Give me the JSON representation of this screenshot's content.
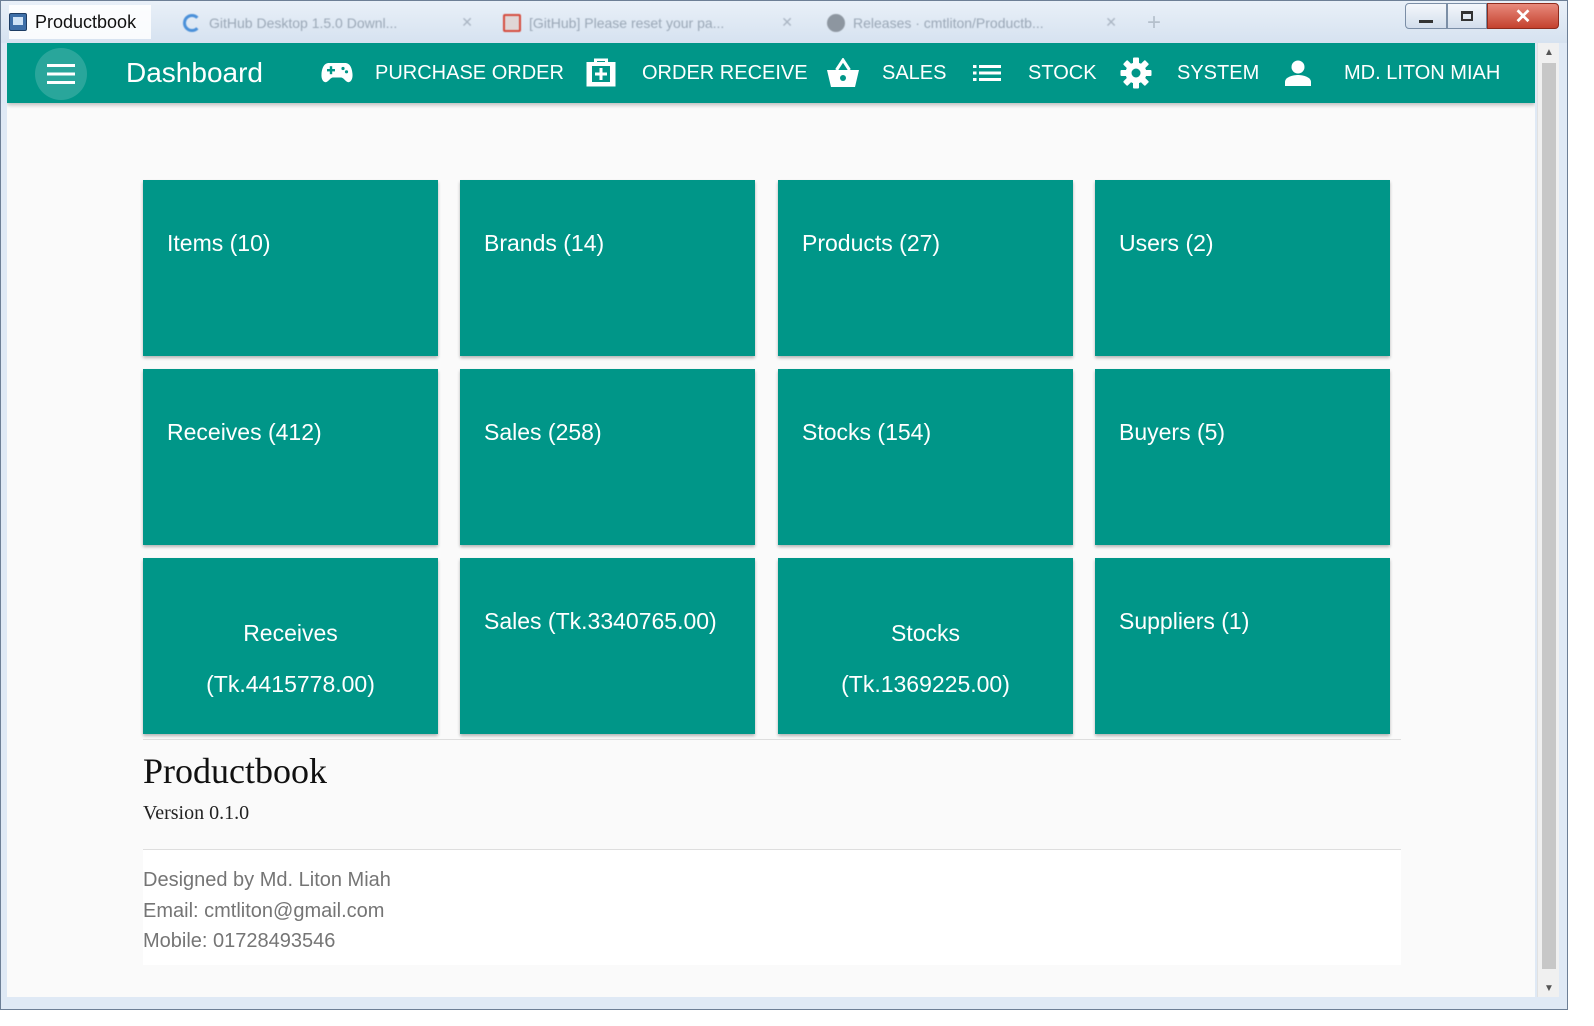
{
  "window": {
    "title": "Productbook",
    "browser_tabs": [
      "GitHub Desktop 1.5.0 Downl...",
      "[GitHub] Please reset your pa...",
      "Releases · cmtliton/Productb..."
    ]
  },
  "toolbar": {
    "page_title": "Dashboard",
    "nav": [
      {
        "label": "PURCHASE ORDER",
        "icon": "gamepad-icon"
      },
      {
        "label": "ORDER RECEIVE",
        "icon": "add-box-icon"
      },
      {
        "label": "SALES",
        "icon": "shopping-basket-icon"
      },
      {
        "label": "STOCK",
        "icon": "list-icon"
      },
      {
        "label": "SYSTEM",
        "icon": "gear-icon"
      },
      {
        "label": "MD. LITON MIAH",
        "icon": "person-icon"
      }
    ]
  },
  "tiles": [
    {
      "label": "Items (10)"
    },
    {
      "label": "Brands (14)"
    },
    {
      "label": "Products (27)"
    },
    {
      "label": "Users (2)"
    },
    {
      "label": "Receives (412)"
    },
    {
      "label": "Sales (258)"
    },
    {
      "label": "Stocks (154)"
    },
    {
      "label": "Buyers (5)"
    },
    {
      "line1": "Receives",
      "line2": "(Tk.4415778.00)"
    },
    {
      "label": "Sales (Tk.3340765.00)"
    },
    {
      "line1": "Stocks",
      "line2": "(Tk.1369225.00)"
    },
    {
      "label": "Suppliers (1)"
    }
  ],
  "about": {
    "product_name": "Productbook",
    "version": "Version 0.1.0"
  },
  "credits": {
    "designer": "Designed by Md. Liton Miah",
    "email": "Email: cmtliton@gmail.com",
    "mobile": "Mobile: 01728493546"
  },
  "colors": {
    "primary": "#009688",
    "background": "#fafafa",
    "muted_text": "#757575"
  }
}
